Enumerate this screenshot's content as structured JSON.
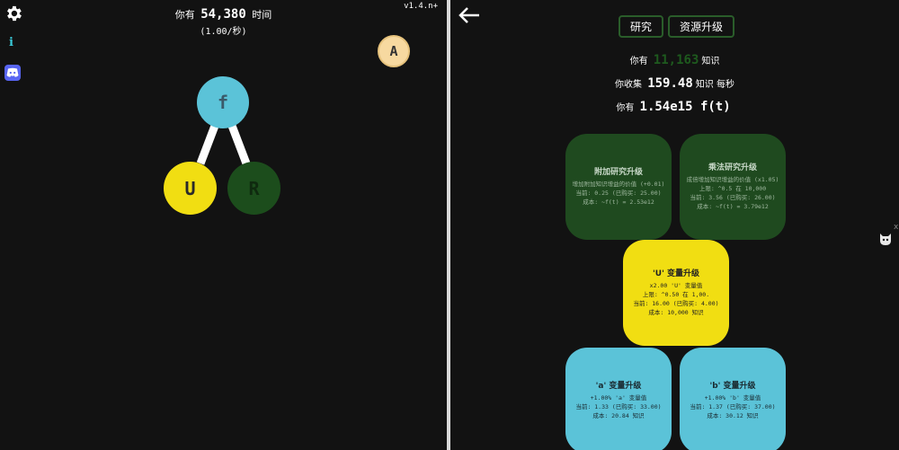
{
  "left": {
    "time_prefix": "你有",
    "time_value": "54,380",
    "time_unit": "时间",
    "time_rate": "(1.00/秒)",
    "version": "v1.4.n+",
    "info_label": "i",
    "icons": {
      "settings": "gear-icon",
      "info": "info-icon",
      "discord": "discord-icon"
    },
    "nodes": {
      "a": "A",
      "f": "f",
      "u": "U",
      "r": "R"
    }
  },
  "right": {
    "tabs": {
      "research": "研究",
      "resource_upgrade": "资源升级"
    },
    "knowledge": {
      "prefix": "你有",
      "value": "11,163",
      "unit": "知识"
    },
    "collect": {
      "prefix": "你收集",
      "value": "159.48",
      "unit": "知识 每秒"
    },
    "ft": {
      "prefix": "你有",
      "value": "1.54e15 f(t)"
    },
    "cards": {
      "add": {
        "title": "附加研究升级",
        "lines": [
          "增加附加知识增益的价值 (+0.01)",
          "当前: 0.25 (已购买: 25.00)",
          "成本: ~f(t) = 2.53e12"
        ]
      },
      "mul": {
        "title": "乘法研究升级",
        "lines": [
          "成倍增加知识增益的价值 (x1.05)",
          "上限: ^0.5 在 10,000",
          "当前: 3.56 (已购买: 26.00)",
          "成本: ~f(t) = 3.79e12"
        ]
      },
      "u": {
        "title": "'U' 变量升级",
        "lines": [
          "x2.00 'U' 变量值",
          "上限: ^0.50 在 1,00.",
          "当前: 16.00 (已购买: 4.00)",
          "成本: 10,000 知识"
        ]
      },
      "a": {
        "title": "'a' 变量升级",
        "lines": [
          "+1.00% 'a' 变量值",
          "当前: 1.33 (已购买: 33.00)",
          "成本: 20.84 知识"
        ]
      },
      "b": {
        "title": "'b' 变量升级",
        "lines": [
          "+1.00% 'b' 变量值",
          "当前: 1.37 (已购买: 37.00)",
          "成本: 30.12 知识"
        ]
      }
    },
    "close_label": "x"
  },
  "colors": {
    "cyan": "#5bc3d8",
    "yellow": "#f1de12",
    "dark_green": "#1f4a1f",
    "peach": "#f7d9a0",
    "divider": "#d8d8d8"
  }
}
